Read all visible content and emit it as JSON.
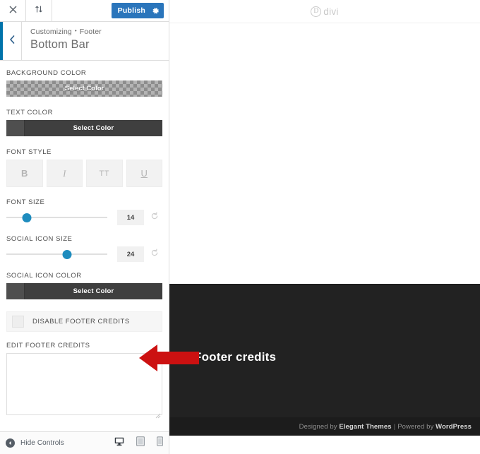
{
  "topbar": {
    "close_icon": "close-icon",
    "reorder_icon": "sort-arrows-icon",
    "publish_label": "Publish",
    "gear_icon": "gear-icon"
  },
  "panel_header": {
    "breadcrumb_root": "Customizing",
    "breadcrumb_separator": "•",
    "breadcrumb_section": "Footer",
    "title": "Bottom Bar",
    "back_icon": "chevron-left-icon",
    "accent_color": "#0073aa"
  },
  "controls": {
    "background_color": {
      "label": "BACKGROUND COLOR",
      "button_label": "Select Color",
      "value": "transparent"
    },
    "text_color": {
      "label": "TEXT COLOR",
      "button_label": "Select Color",
      "swatch": "#4f4f4f",
      "body_color": "#3f3f3f"
    },
    "font_style": {
      "label": "FONT STYLE",
      "buttons": [
        {
          "name": "bold",
          "glyph": "B"
        },
        {
          "name": "italic",
          "glyph": "I"
        },
        {
          "name": "uppercase",
          "glyph": "TT"
        },
        {
          "name": "underline",
          "glyph": "U"
        }
      ]
    },
    "font_size": {
      "label": "FONT SIZE",
      "value": "14",
      "percent": 20,
      "reset_icon": "reset-icon"
    },
    "social_icon_size": {
      "label": "SOCIAL ICON SIZE",
      "value": "24",
      "percent": 60,
      "reset_icon": "reset-icon"
    },
    "social_icon_color": {
      "label": "SOCIAL ICON COLOR",
      "button_label": "Select Color",
      "swatch": "#4f4f4f",
      "body_color": "#3f3f3f"
    },
    "disable_footer_credits": {
      "label": "DISABLE FOOTER CREDITS",
      "checked": false
    },
    "edit_footer_credits": {
      "label": "EDIT FOOTER CREDITS",
      "value": "",
      "placeholder": ""
    }
  },
  "panel_footer": {
    "hide_controls_label": "Hide Controls",
    "hide_controls_icon": "arrow-left-circle-icon",
    "devices": [
      {
        "name": "desktop",
        "icon": "desktop-icon",
        "active": true
      },
      {
        "name": "tablet",
        "icon": "tablet-icon",
        "active": false
      },
      {
        "name": "mobile",
        "icon": "mobile-icon",
        "active": false
      }
    ]
  },
  "preview": {
    "logo_mark": "D",
    "logo_text": "divi",
    "annotation_label": "Footer credits",
    "credits": {
      "designed_by": "Designed by",
      "designer": "Elegant Themes",
      "separator": "|",
      "powered_by": "Powered by",
      "platform": "WordPress"
    },
    "footer_bg": "#222222",
    "bottom_bar_bg": "#1c1c1c"
  },
  "annotation": {
    "arrow_color": "#cc1111",
    "arrow_direction": "left"
  }
}
